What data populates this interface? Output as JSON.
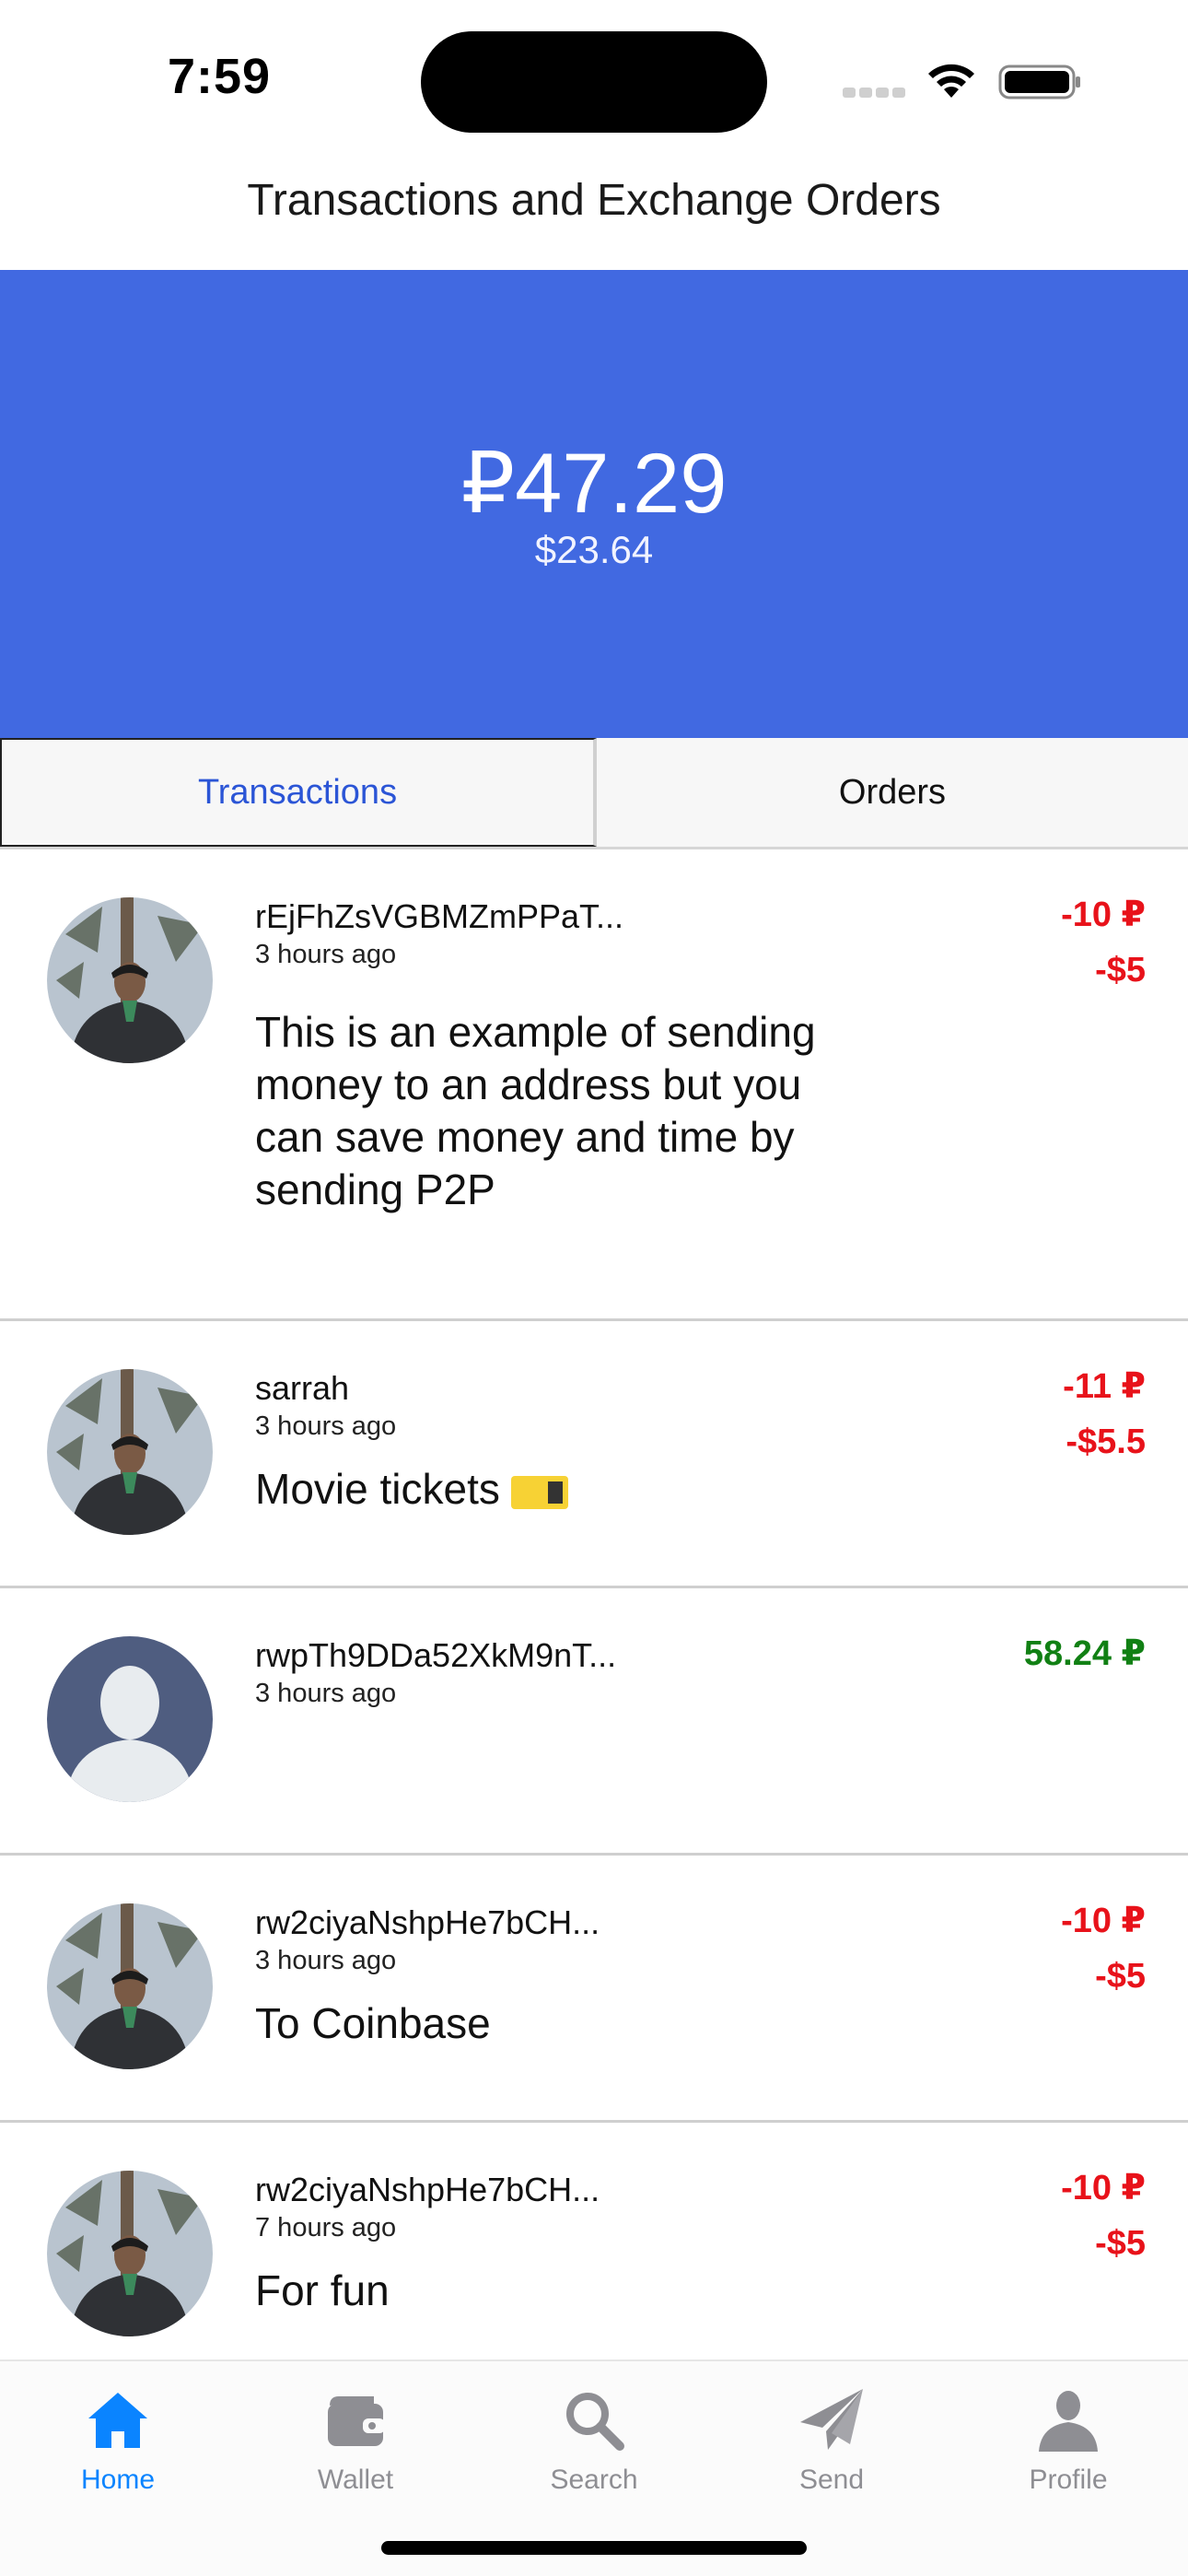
{
  "status": {
    "time": "7:59"
  },
  "title": "Transactions and Exchange Orders",
  "balance": {
    "primary": "₽47.29",
    "secondary": "$23.64"
  },
  "tabs": [
    {
      "label": "Transactions",
      "active": true
    },
    {
      "label": "Orders",
      "active": false
    }
  ],
  "transactions": [
    {
      "name": "rEjFhZsVGBMZmPPaT...",
      "time": "3 hours ago",
      "memo": "This is an example of sending money to an address but you can save money and time by sending P2P",
      "amount": "-10 ₽",
      "fiat": "-$5",
      "avatar": "photo"
    },
    {
      "name": "sarrah",
      "time": "3 hours ago",
      "memo": "Movie tickets",
      "memo_icon": "ticket-icon",
      "amount": "-11 ₽",
      "fiat": "-$5.5",
      "avatar": "photo"
    },
    {
      "name": "rwpTh9DDa52XkM9nT...",
      "time": "3 hours ago",
      "memo": "",
      "amount": "58.24 ₽",
      "fiat": "",
      "avatar": "placeholder"
    },
    {
      "name": "rw2ciyaNshpHe7bCH...",
      "time": "3 hours ago",
      "memo": "To Coinbase",
      "amount": "-10 ₽",
      "fiat": "-$5",
      "avatar": "photo"
    },
    {
      "name": "rw2ciyaNshpHe7bCH...",
      "time": "7 hours ago",
      "memo": "For fun",
      "amount": "-10 ₽",
      "fiat": "-$5",
      "avatar": "photo"
    }
  ],
  "tabbar": [
    {
      "label": "Home",
      "icon": "home-icon",
      "active": true
    },
    {
      "label": "Wallet",
      "icon": "wallet-icon",
      "active": false
    },
    {
      "label": "Search",
      "icon": "search-icon",
      "active": false
    },
    {
      "label": "Send",
      "icon": "send-icon",
      "active": false
    },
    {
      "label": "Profile",
      "icon": "profile-icon",
      "active": false
    }
  ],
  "colors": {
    "banner": "#4169e1",
    "active_tab": "#2b55d6",
    "negative": "#e8121a",
    "positive": "#118014",
    "tabbar_active": "#0a84ff"
  }
}
